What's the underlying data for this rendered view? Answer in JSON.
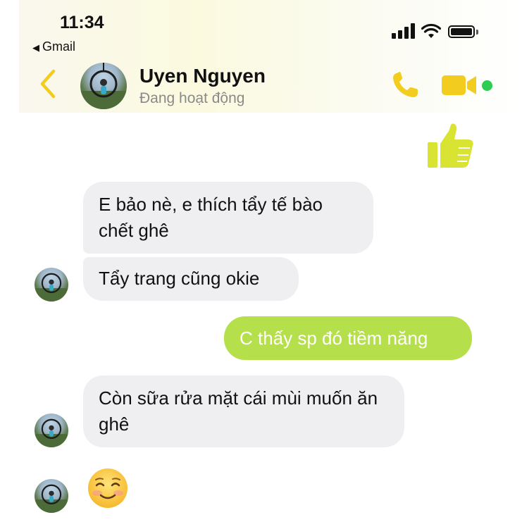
{
  "status_bar": {
    "time": "11:34",
    "back_app_label": "Gmail"
  },
  "header": {
    "contact_name": "Uyen Nguyen",
    "contact_status": "Đang hoạt động",
    "accent_color": "#f2cc1f",
    "online_color": "#2ecc50"
  },
  "icons": {
    "back": "chevron-left-icon",
    "call": "phone-icon",
    "video": "video-camera-icon",
    "reaction": "thumbs-up-icon",
    "emoji": "smiling-face-emoji"
  },
  "messages": [
    {
      "from": "them",
      "text": "E bảo nè, e thích tẩy tế bào chết ghê"
    },
    {
      "from": "them",
      "text": "Tẩy trang cũng okie"
    },
    {
      "from": "me",
      "text": "C thấy sp đó tiềm năng",
      "color": "#b5e04c"
    },
    {
      "from": "them",
      "text": "Còn sữa rửa mặt cái mùi muốn ăn ghê"
    },
    {
      "from": "them",
      "text": "☺️",
      "type": "emoji"
    }
  ]
}
